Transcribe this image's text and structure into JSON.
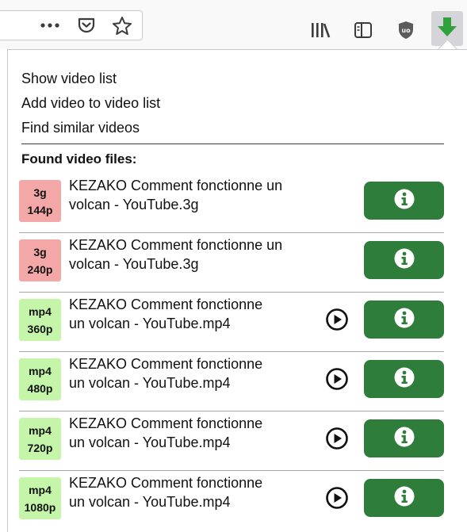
{
  "toolbar": {
    "icons": [
      "more-icon",
      "pocket-icon",
      "star-icon",
      "library-icon",
      "sidebar-icon",
      "ublock-icon",
      "download-icon"
    ],
    "accent": "#2fa03a"
  },
  "menu": {
    "show_list": "Show video list",
    "add_to_list": "Add video to video list",
    "find_similar": "Find similar videos"
  },
  "found_label": "Found video files:",
  "videos": [
    {
      "format": "3g",
      "quality": "144p",
      "title1": "KEZAKO Comment fonctionne un",
      "title2": "volcan - YouTube.3g",
      "color": "red",
      "playable": false
    },
    {
      "format": "3g",
      "quality": "240p",
      "title1": "KEZAKO Comment fonctionne un",
      "title2": "volcan - YouTube.3g",
      "color": "red",
      "playable": false
    },
    {
      "format": "mp4",
      "quality": "360p",
      "title1": "KEZAKO Comment fonctionne",
      "title2": "un volcan - YouTube.mp4",
      "color": "green",
      "playable": true
    },
    {
      "format": "mp4",
      "quality": "480p",
      "title1": "KEZAKO Comment fonctionne",
      "title2": "un volcan - YouTube.mp4",
      "color": "green",
      "playable": true
    },
    {
      "format": "mp4",
      "quality": "720p",
      "title1": "KEZAKO Comment fonctionne",
      "title2": "un volcan - YouTube.mp4",
      "color": "green",
      "playable": true
    },
    {
      "format": "mp4",
      "quality": "1080p",
      "title1": "KEZAKO Comment fonctionne",
      "title2": "un volcan - YouTube.mp4",
      "color": "green",
      "playable": true
    }
  ],
  "colors": {
    "badge_red": "#f4a7a7",
    "badge_green": "#c4f5a8",
    "info_button": "#2f7d3a"
  }
}
